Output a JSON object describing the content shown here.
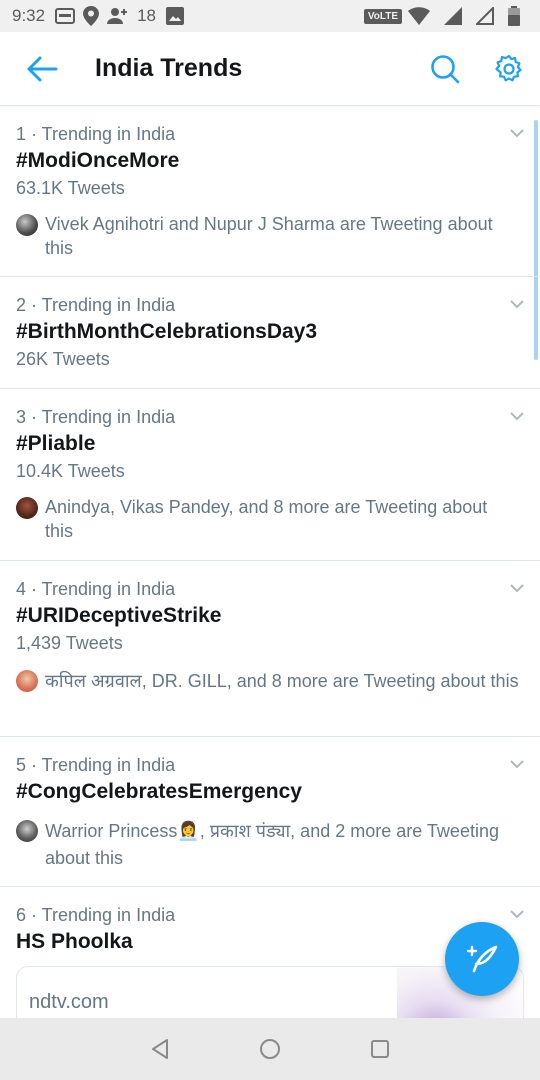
{
  "status_bar": {
    "time": "9:32",
    "notification_count": "18",
    "network_label": "VoLTE",
    "icons": [
      "news-icon",
      "location-pin-icon",
      "add-person-icon",
      "image-icon",
      "wifi-icon",
      "signal-icon",
      "battery-icon"
    ]
  },
  "header": {
    "title": "India Trends",
    "back_icon": "back-arrow-icon",
    "search_icon": "search-icon",
    "settings_icon": "gear-icon"
  },
  "colors": {
    "accent": "#1da1f2",
    "secondary_text": "#657786",
    "primary_text": "#14171a",
    "divider": "#e1e8ed"
  },
  "trends": [
    {
      "meta": "1 · Trending in India",
      "name": "#ModiOnceMore",
      "count": "63.1K Tweets",
      "social": "Vivek Agnihotri and Nupur J Sharma are Tweeting about this"
    },
    {
      "meta": "2 · Trending in India",
      "name": "#BirthMonthCelebrationsDay3",
      "count": "26K Tweets"
    },
    {
      "meta": "3 · Trending in India",
      "name": "#Pliable",
      "count": "10.4K Tweets",
      "social": "Anindya, Vikas Pandey, and 8 more are Tweeting about this"
    },
    {
      "meta": "4 · Trending in India",
      "name": "#URIDeceptiveStrike",
      "count": "1,439 Tweets",
      "social": "कपिल अग्रवाल, DR. GILL, and 8 more are Tweeting about this"
    },
    {
      "meta": "5 · Trending in India",
      "name": "#CongCelebratesEmergency",
      "social": "Warrior Princess👩‍💼, प्रकाश पंड्या, and 2 more are Tweeting about this"
    },
    {
      "meta": "6 · Trending in India",
      "name": "HS Phoolka",
      "card_domain": "ndtv.com"
    }
  ],
  "fab": {
    "icon": "compose-tweet-icon"
  },
  "nav": {
    "icons": [
      "back-triangle-icon",
      "home-circle-icon",
      "recents-square-icon"
    ]
  }
}
